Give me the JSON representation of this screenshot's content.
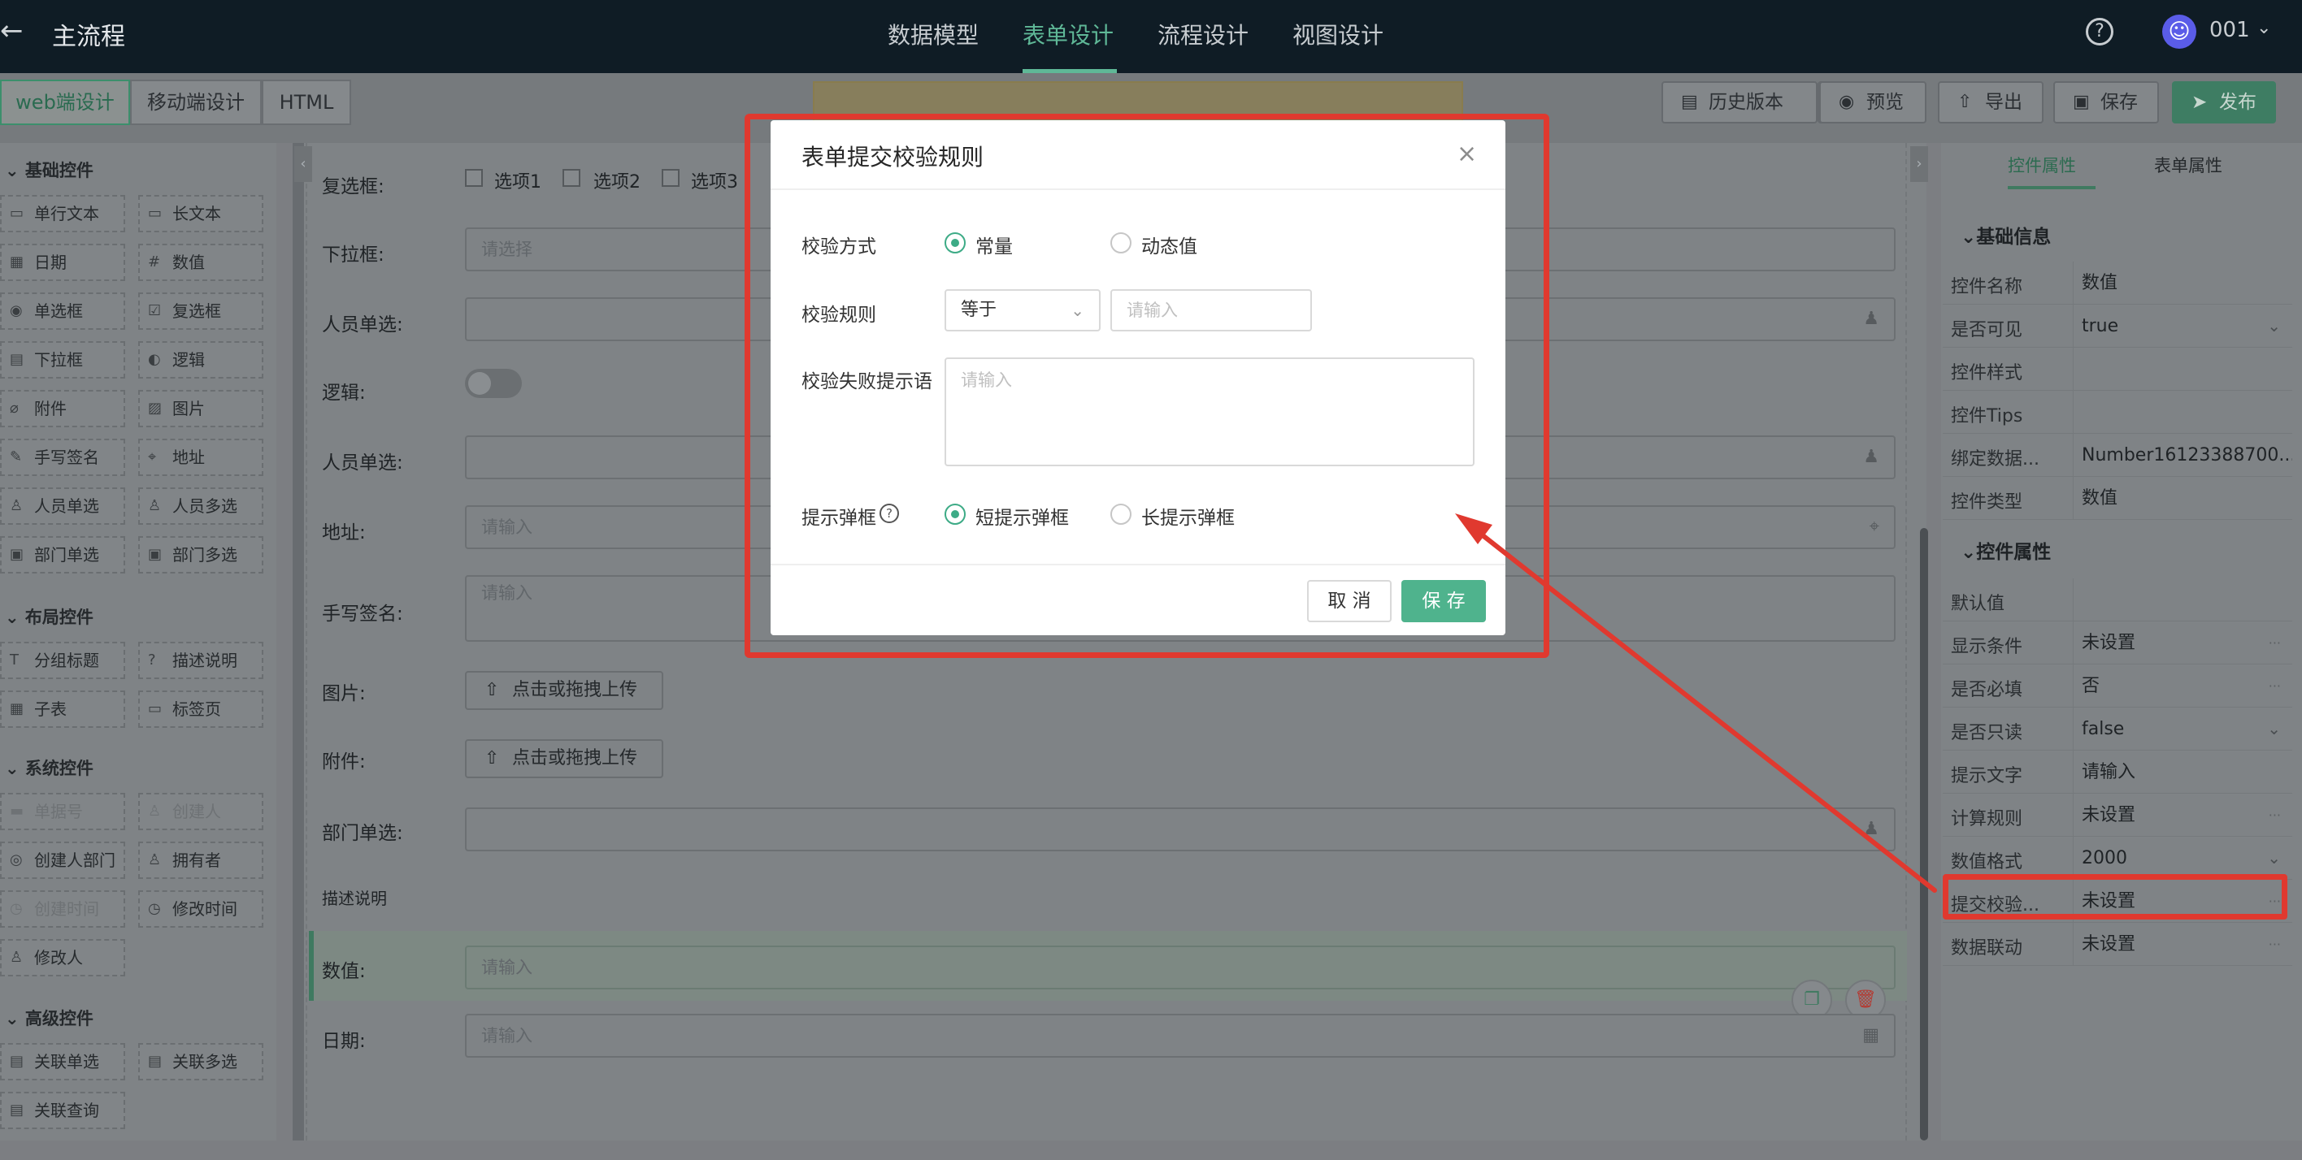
{
  "header": {
    "back_icon": "arrow-left-icon",
    "title": "主流程",
    "tabs": [
      {
        "label": "数据模型"
      },
      {
        "label": "表单设计",
        "active": true
      },
      {
        "label": "流程设计"
      },
      {
        "label": "视图设计"
      }
    ],
    "help_icon": "question-circle-icon",
    "user": "001",
    "accent_color": "#5fb897"
  },
  "toolbar": {
    "modes": [
      "web端设计",
      "移动端设计",
      "HTML"
    ],
    "history": "历史版本",
    "preview": "预览",
    "export": "导出",
    "save": "保存",
    "publish": "发布"
  },
  "palette": {
    "groups": [
      {
        "title": "基础控件",
        "items": [
          "单行文本",
          "长文本",
          "日期",
          "数值",
          "单选框",
          "复选框",
          "下拉框",
          "逻辑",
          "附件",
          "图片",
          "手写签名",
          "地址",
          "人员单选",
          "人员多选",
          "部门单选",
          "部门多选"
        ]
      },
      {
        "title": "布局控件",
        "items": [
          "分组标题",
          "描述说明",
          "子表",
          "标签页"
        ]
      },
      {
        "title": "系统控件",
        "items": [
          "单据号",
          "创建人",
          "创建人部门",
          "拥有者",
          "创建时间",
          "修改时间",
          "修改人"
        ]
      },
      {
        "title": "高级控件",
        "items": [
          "关联单选",
          "关联多选",
          "关联查询"
        ]
      }
    ]
  },
  "form": {
    "checkbox_label": "复选框:",
    "checkbox_options": [
      "选项1",
      "选项2",
      "选项3"
    ],
    "dropdown_label": "下拉框:",
    "dropdown_placeholder": "请选择",
    "user_single_label": "人员单选:",
    "logic_label": "逻辑:",
    "user_single2_label": "人员单选:",
    "address_label": "地址:",
    "address_placeholder": "请输入",
    "signature_label": "手写签名:",
    "signature_placeholder": "请输入",
    "image_label": "图片:",
    "upload_text": "点击或拖拽上传",
    "attachment_label": "附件:",
    "dept_label": "部门单选:",
    "desc_text": "描述说明",
    "number_label": "数值:",
    "number_placeholder": "请输入",
    "date_label": "日期:",
    "date_placeholder": "请输入"
  },
  "right_panel": {
    "tabs": [
      "控件属性",
      "表单属性"
    ],
    "basic_title": "基础信息",
    "basic": [
      {
        "k": "控件名称",
        "v": "数值"
      },
      {
        "k": "是否可见",
        "v": "true",
        "chev": true
      },
      {
        "k": "控件样式",
        "v": ""
      },
      {
        "k": "控件Tips",
        "v": ""
      },
      {
        "k": "绑定数据...",
        "v": "Number16123388700..."
      },
      {
        "k": "控件类型",
        "v": "数值"
      }
    ],
    "props_title": "控件属性",
    "props": [
      {
        "k": "默认值",
        "v": ""
      },
      {
        "k": "显示条件",
        "v": "未设置",
        "more": true
      },
      {
        "k": "是否必填",
        "v": "否",
        "more": true
      },
      {
        "k": "是否只读",
        "v": "false",
        "chev": true
      },
      {
        "k": "提示文字",
        "v": "请输入"
      },
      {
        "k": "计算规则",
        "v": "未设置",
        "more": true
      },
      {
        "k": "数值格式",
        "v": "2000",
        "chev": true
      },
      {
        "k": "提交校验...",
        "v": "未设置",
        "more": true
      },
      {
        "k": "数据联动",
        "v": "未设置",
        "more": true
      }
    ]
  },
  "modal": {
    "title": "表单提交校验规则",
    "method_label": "校验方式",
    "method_options": [
      "常量",
      "动态值"
    ],
    "rule_label": "校验规则",
    "rule_operator": "等于",
    "rule_value_placeholder": "请输入",
    "fail_msg_label": "校验失败提示语",
    "fail_msg_placeholder": "请输入",
    "popup_label": "提示弹框",
    "popup_options": [
      "短提示弹框",
      "长提示弹框"
    ],
    "cancel": "取 消",
    "save": "保 存",
    "primary_color": "#4fb38d"
  },
  "annotation": {
    "color": "#e0392f"
  }
}
